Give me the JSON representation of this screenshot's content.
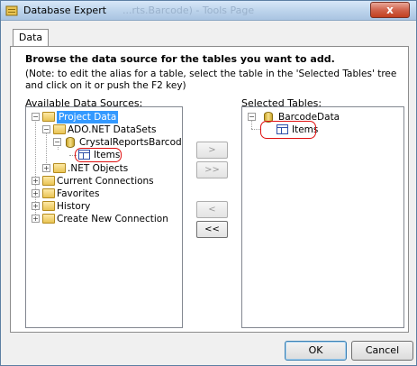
{
  "window": {
    "title": "Database Expert",
    "background_title": "...rts.Barcode) - Tools Page",
    "close_glyph": "x"
  },
  "tabs": [
    {
      "label": "Data"
    }
  ],
  "instruction": "Browse the data source for the tables you want to add.",
  "note": "(Note: to edit the alias for a table, select the table in the 'Selected Tables' tree and click on it or push the F2 key)",
  "available": {
    "label_prefix": "A",
    "label_rest": "vailable Data Sources:",
    "tree": {
      "project_data": "Project Data",
      "ado_datasets": "ADO.NET DataSets",
      "crystal_item": "CrystalReportsBarcode.Barc",
      "items": "Items",
      "net_objects": ".NET Objects",
      "current_connections": "Current Connections",
      "favorites": "Favorites",
      "history": "History",
      "create_new_connection": "Create New Connection"
    }
  },
  "selected": {
    "label_prefix": "S",
    "label_rest": "elected Tables:",
    "tree": {
      "barcode_data": "BarcodeData",
      "items": "Items"
    }
  },
  "move_buttons": {
    "add": ">",
    "add_all": ">>",
    "remove": "<",
    "remove_all": "<<"
  },
  "footer": {
    "ok": "OK",
    "cancel": "Cancel"
  },
  "icons": [
    "app-icon",
    "folder-icon",
    "database-icon",
    "table-icon",
    "expand-icon",
    "collapse-icon"
  ],
  "colors": {
    "selection": "#3399ff",
    "annotation": "#e01010",
    "title_bar": "#b9d1ea"
  }
}
